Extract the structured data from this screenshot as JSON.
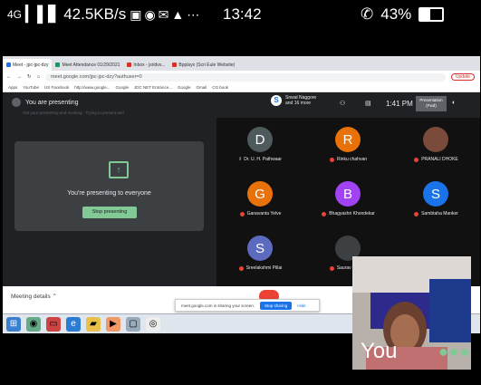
{
  "status_bar": {
    "network": "4G",
    "speed": "42.5KB/s",
    "time": "13:42",
    "battery": "43%",
    "battery_level": 0.43
  },
  "browser": {
    "tabs": [
      {
        "label": "Meet - jpc-jpc-dzy",
        "color": "#1a73e8"
      },
      {
        "label": "Meet Attendance 01/29/2021",
        "color": "#0f9d58"
      },
      {
        "label": "Inbox - jsridvs...",
        "color": "#d93025"
      },
      {
        "label": "Bpplayx (Scri Eule Website)",
        "color": "#d93025"
      }
    ],
    "url": "meet.google.com/jpc-jpc-dzy?authuser=0",
    "update_label": "Update",
    "bookmarks": [
      "Apps",
      "YouTube",
      "US Facebook",
      "http://www.google...",
      "Google",
      "JDC NET Entrance...",
      "Google",
      "Gmail",
      "CG book"
    ]
  },
  "meet": {
    "presenting_label": "You are presenting",
    "hint_text": "Get your presenting and meeting · Trying to present and",
    "participant_name": "Snwal Naggore",
    "participant_more": "and 16 more",
    "clock": "1:41 PM",
    "presentation_label": "Presentation (Fwd)",
    "presenting_to_everyone": "You're presenting to everyone",
    "stop_presenting": "Stop presenting",
    "participants": [
      {
        "initial": "D",
        "name": "Dr. U. H. Pathwaar",
        "color": "#4e5a5c",
        "mic": "on"
      },
      {
        "initial": "R",
        "name": "Rinku chahvan",
        "color": "#e8710a",
        "mic": "off"
      },
      {
        "initial": "",
        "name": "PRANALI DHOKE",
        "color": "#7a4a3a",
        "mic": "off"
      },
      {
        "initial": "G",
        "name": "Ganavanta Yelve",
        "color": "#e8710a",
        "mic": "off"
      },
      {
        "initial": "B",
        "name": "Bhagyashri Khondekar",
        "color": "#a142f4",
        "mic": "off"
      },
      {
        "initial": "S",
        "name": "Sambtaha Manker",
        "color": "#1a73e8",
        "mic": "off"
      },
      {
        "initial": "S",
        "name": "Sreelakshmi Pillai",
        "color": "#5c6bc0",
        "mic": "off"
      },
      {
        "initial": "",
        "name": "Saurav Kharde",
        "color": "#3c4043",
        "mic": "off"
      }
    ],
    "meeting_details": "Meeting details",
    "share_message": "meet.google.com is sharing your screen.",
    "stop_sharing": "Stop sharing",
    "hide": "Hide",
    "self_label": "You"
  }
}
